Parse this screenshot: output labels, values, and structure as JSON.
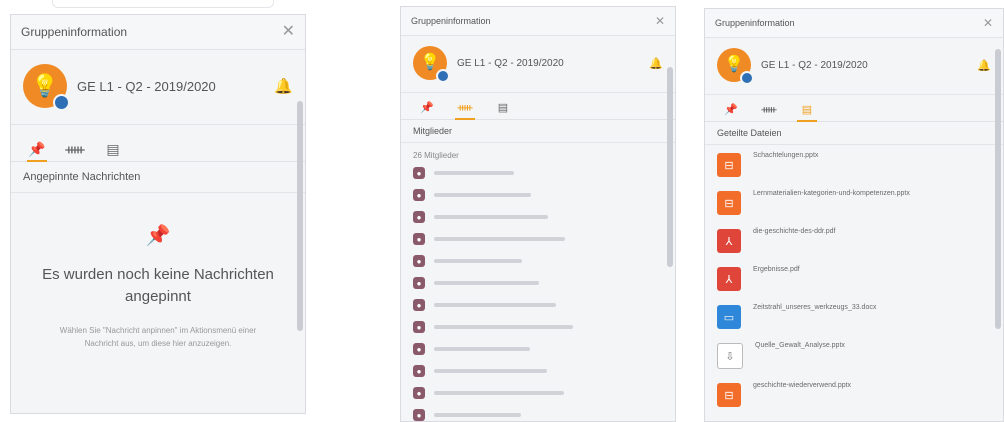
{
  "panel1": {
    "title": "Gruppeninformation",
    "group_name": "GE L1 - Q2 - 2019/2020",
    "section": "Angepinnte Nachrichten",
    "empty_title": "Es wurden noch keine Nachrichten angepinnt",
    "empty_hint": "Wählen Sie \"Nachricht anpinnen\" im Aktionsmenü einer Nachricht aus, um diese hier anzuzeigen."
  },
  "panel2": {
    "title": "Gruppeninformation",
    "group_name": "GE L1 - Q2 - 2019/2020",
    "section": "Mitglieder",
    "member_count": "26 Mitglieder"
  },
  "panel3": {
    "title": "Gruppeninformation",
    "group_name": "GE L1 - Q2 - 2019/2020",
    "section": "Geteilte Dateien",
    "files": [
      {
        "name": "Schachtelungen.pptx",
        "type": "ppt"
      },
      {
        "name": "Lernmaterialien-kategorien-und-kompetenzen.pptx",
        "type": "ppt"
      },
      {
        "name": "die-geschichte-des-ddr.pdf",
        "type": "pdf"
      },
      {
        "name": "Ergebnisse.pdf",
        "type": "pdf"
      },
      {
        "name": "Zeitstrahl_unseres_werkzeugs_33.docx",
        "type": "doc"
      },
      {
        "name": "Quelle_Gewalt_Analyse.pptx",
        "type": "gen"
      },
      {
        "name": "geschichte-wiederverwend.pptx",
        "type": "ppt"
      }
    ]
  },
  "icons": {
    "group_avatar": "lightbulb-icon",
    "notifications": "bell-icon",
    "pinned_tab": "pin-icon",
    "members_tab": "members-icon",
    "files_tab": "files-icon"
  },
  "colors": {
    "accent": "#f0a020",
    "avatar": "#f08a24",
    "pin": "#8b5cc8",
    "member_icon": "#8a5a6a",
    "ppt": "#f26c2a",
    "pdf": "#e0453a",
    "doc": "#2e87d8"
  }
}
